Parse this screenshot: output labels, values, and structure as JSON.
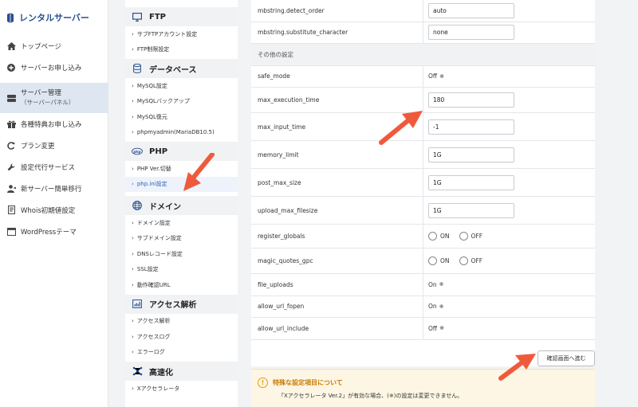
{
  "brand": {
    "title": "レンタルサーバー"
  },
  "sidebar": {
    "items": [
      {
        "label": "トップページ",
        "icon": "home-icon"
      },
      {
        "label": "サーバーお申し込み",
        "icon": "plus-circle-icon"
      },
      {
        "label": "サーバー管理",
        "sub": "（サーバーパネル）",
        "icon": "server-icon",
        "active": true
      },
      {
        "label": "各種特典お申し込み",
        "icon": "gift-icon"
      },
      {
        "label": "プラン変更",
        "icon": "refresh-icon"
      },
      {
        "label": "設定代行サービス",
        "icon": "wrench-icon"
      },
      {
        "label": "新サーバー簡単移行",
        "icon": "user-move-icon"
      },
      {
        "label": "Whois初期値設定",
        "icon": "document-icon"
      },
      {
        "label": "WordPressテーマ",
        "icon": "window-icon"
      }
    ]
  },
  "submenu": {
    "ftp": {
      "title": "FTP",
      "links": [
        "サブFTPアカウント設定",
        "FTP制限設定"
      ]
    },
    "db": {
      "title": "データベース",
      "links": [
        "MySQL設定",
        "MySQLバックアップ",
        "MySQL復元",
        "phpmyadmin(MariaDB10.5)"
      ]
    },
    "php": {
      "title": "PHP",
      "badge": "php",
      "links": [
        "PHP Ver.切替",
        "php.ini設定"
      ]
    },
    "domain": {
      "title": "ドメイン",
      "links": [
        "ドメイン設定",
        "サブドメイン設定",
        "DNSレコード設定",
        "SSL設定",
        "動作確認URL"
      ]
    },
    "access": {
      "title": "アクセス解析",
      "links": [
        "アクセス解析",
        "アクセスログ",
        "エラーログ"
      ]
    },
    "speed": {
      "title": "高速化",
      "links": [
        "Xアクセラレータ"
      ]
    }
  },
  "settings": {
    "mbstring_detect_order": {
      "key": "mbstring.detect_order",
      "value": "auto"
    },
    "mbstring_substitute_character": {
      "key": "mbstring.substitute_character",
      "value": "none"
    },
    "group_other": "その他の設定",
    "safe_mode": {
      "key": "safe_mode",
      "value": "Off"
    },
    "max_execution_time": {
      "key": "max_execution_time",
      "value": "180"
    },
    "max_input_time": {
      "key": "max_input_time",
      "value": "-1"
    },
    "memory_limit": {
      "key": "memory_limit",
      "value": "1G"
    },
    "post_max_size": {
      "key": "post_max_size",
      "value": "1G"
    },
    "upload_max_filesize": {
      "key": "upload_max_filesize",
      "value": "1G"
    },
    "register_globals": {
      "key": "register_globals",
      "on": "ON",
      "off": "OFF"
    },
    "magic_quotes_gpc": {
      "key": "magic_quotes_gpc",
      "on": "ON",
      "off": "OFF"
    },
    "file_uploads": {
      "key": "file_uploads",
      "value": "On"
    },
    "allow_url_fopen": {
      "key": "allow_url_fopen",
      "value": "On"
    },
    "allow_url_include": {
      "key": "allow_url_include",
      "value": "Off"
    },
    "asterisk": "※"
  },
  "confirm_button": "確認画面へ進む",
  "notice": {
    "title": "特殊な設定項目について",
    "body": "「Xアクセラレータ Ver.2」が有効な場合、(※)の設定は変更できません。"
  },
  "colors": {
    "brand": "#2a4f8f",
    "active_link": "#2d5fb8",
    "arrow": "#ef5a3c",
    "notice_bg": "#fdf6e4"
  }
}
